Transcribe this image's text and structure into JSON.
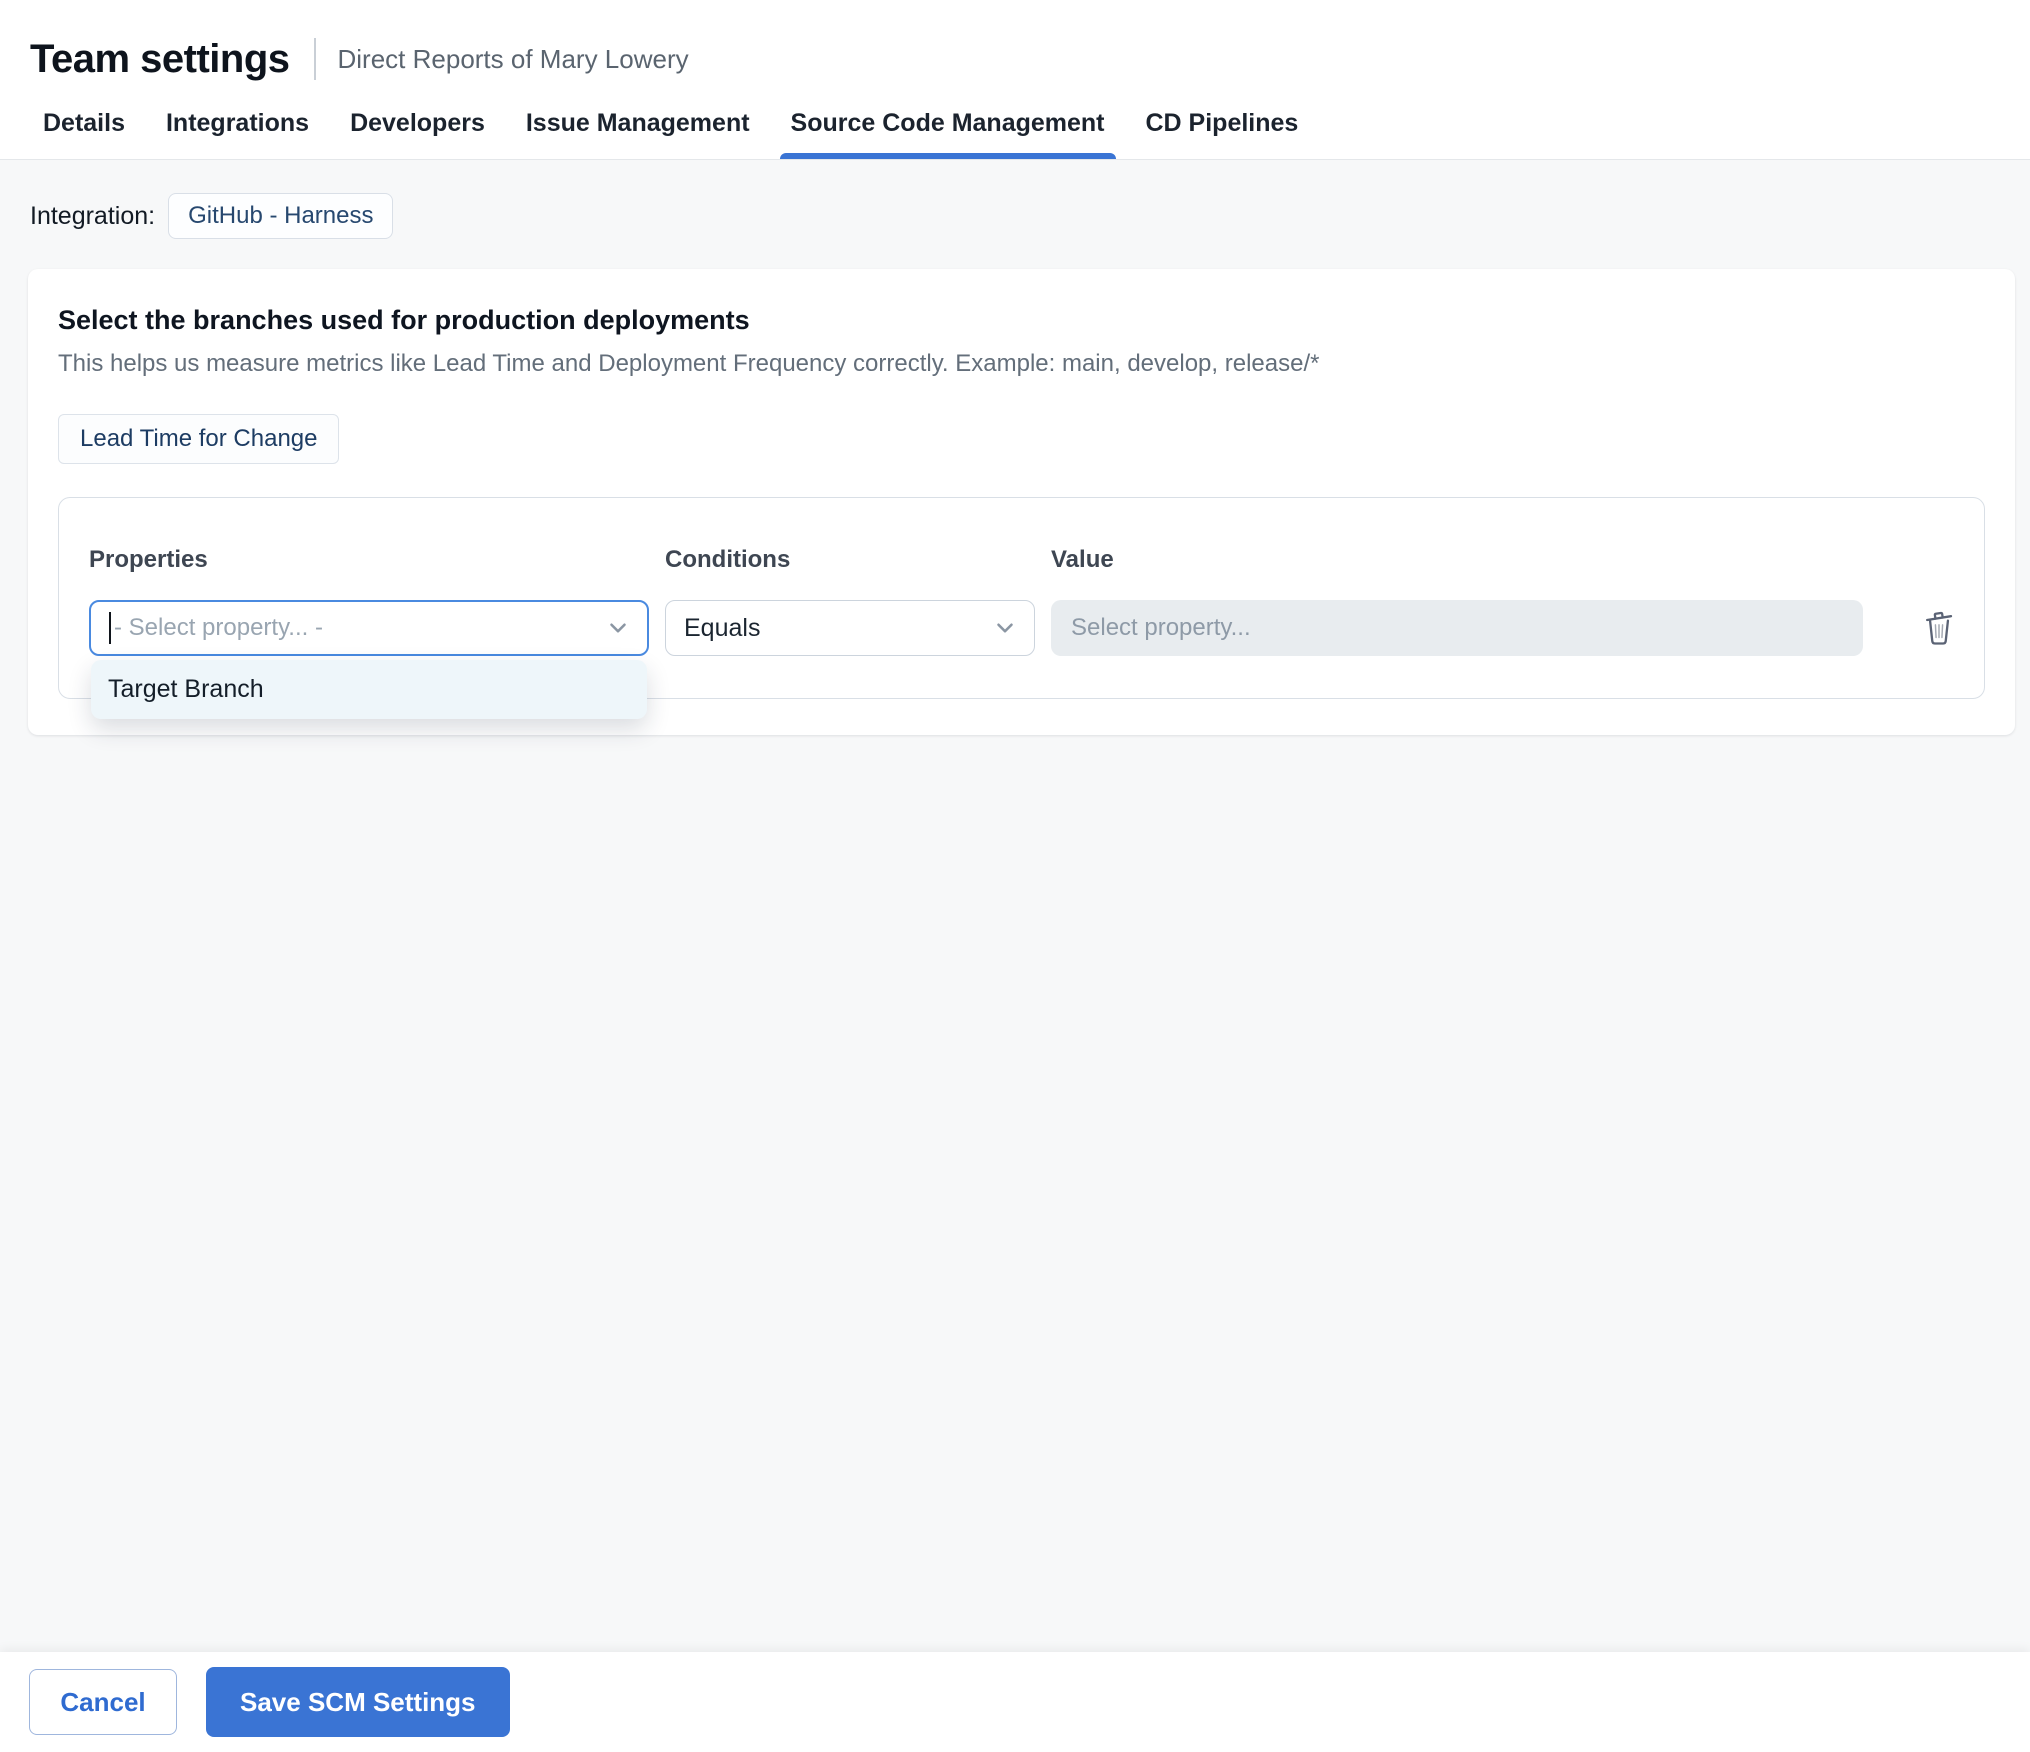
{
  "header": {
    "title": "Team settings",
    "subtitle": "Direct Reports of Mary Lowery"
  },
  "tabs": [
    {
      "label": "Details",
      "active": false
    },
    {
      "label": "Integrations",
      "active": false
    },
    {
      "label": "Developers",
      "active": false
    },
    {
      "label": "Issue Management",
      "active": false
    },
    {
      "label": "Source Code Management",
      "active": true
    },
    {
      "label": "CD Pipelines",
      "active": false
    }
  ],
  "integration": {
    "label": "Integration:",
    "value": "GitHub - Harness"
  },
  "card": {
    "title": "Select the branches used for production deployments",
    "description": "This helps us measure metrics like Lead Time and Deployment Frequency correctly. Example: main, develop, release/*",
    "metric_chip": "Lead Time for Change",
    "columns": {
      "properties": "Properties",
      "conditions": "Conditions",
      "value": "Value"
    },
    "property_select": {
      "placeholder": "- Select property... -"
    },
    "condition_select": {
      "value": "Equals"
    },
    "value_input": {
      "placeholder": "Select property...",
      "disabled": true
    },
    "dropdown": {
      "options": [
        "Target Branch"
      ]
    }
  },
  "footer": {
    "cancel_label": "Cancel",
    "save_label": "Save SCM Settings"
  },
  "colors": {
    "accent": "#3a74d4",
    "focus-border": "#4a8ae0",
    "page-bg": "#f7f8f9",
    "disabled-bg": "#e8ecef",
    "dropdown-bg": "#eef6fa"
  }
}
